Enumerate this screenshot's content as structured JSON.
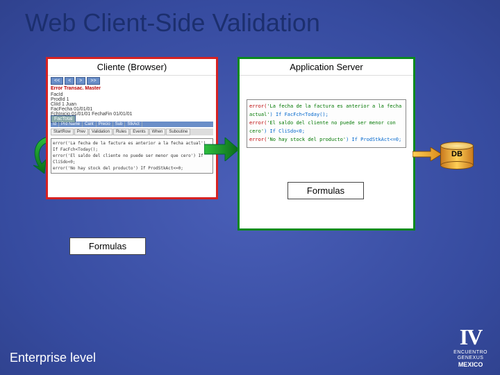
{
  "title": "Web Client-Side Validation",
  "client": {
    "label": "Cliente (Browser)",
    "mock": {
      "red_title": "Error Transac. Master",
      "buttons": [
        "<<",
        "<",
        ">",
        ">>"
      ],
      "fields": [
        "FacId",
        "ProdId  1",
        "CliId  1  Juan",
        "FacFecha 01/01/01",
        "FchInicio 01/01/01  FechaFin 01/01/01"
      ],
      "action_btn": "FacTotal",
      "grid_headers": [
        "Id",
        "Prd Name",
        "Cant",
        "Precio",
        "Sub",
        "StkAct"
      ],
      "tabs": [
        "StartRow",
        "Prev",
        "Validation",
        "Rules",
        "Events",
        "When",
        "Suboutine"
      ],
      "code": [
        "error('La fecha de la factura es anterior a la fecha actual') If FacFch<Today();",
        "error('El saldo del cliente no puede ser menor que cero') If CliSdo<0;",
        "error('No hay stock del producto') If ProdStkAct<=0;"
      ]
    },
    "formulas_label": "Formulas"
  },
  "server": {
    "label": "Application Server",
    "code": [
      {
        "kw": "error(",
        "msg": "'La fecha de la factura es anterior a la fecha actual'",
        "tail": ") If FacFch<Today();"
      },
      {
        "kw": "error(",
        "msg": "'El saldo del cliente no puede ser menor con cero'",
        "tail": ") If CliSdo<0;"
      },
      {
        "kw": "error(",
        "msg": "'No hay stock del producto'",
        "tail": ") If ProdStkAct<=0;"
      }
    ],
    "formulas_label": "Formulas"
  },
  "db": {
    "label": "DB"
  },
  "footer": "Enterprise level",
  "logo": {
    "iv": "IV",
    "line1": "ENCUENTRO",
    "line2": "GENEXUS",
    "line3": "MEXICO"
  },
  "colors": {
    "client_border": "#d62222",
    "server_border": "#0a8a1e",
    "db_fill": "#ffcf55"
  }
}
